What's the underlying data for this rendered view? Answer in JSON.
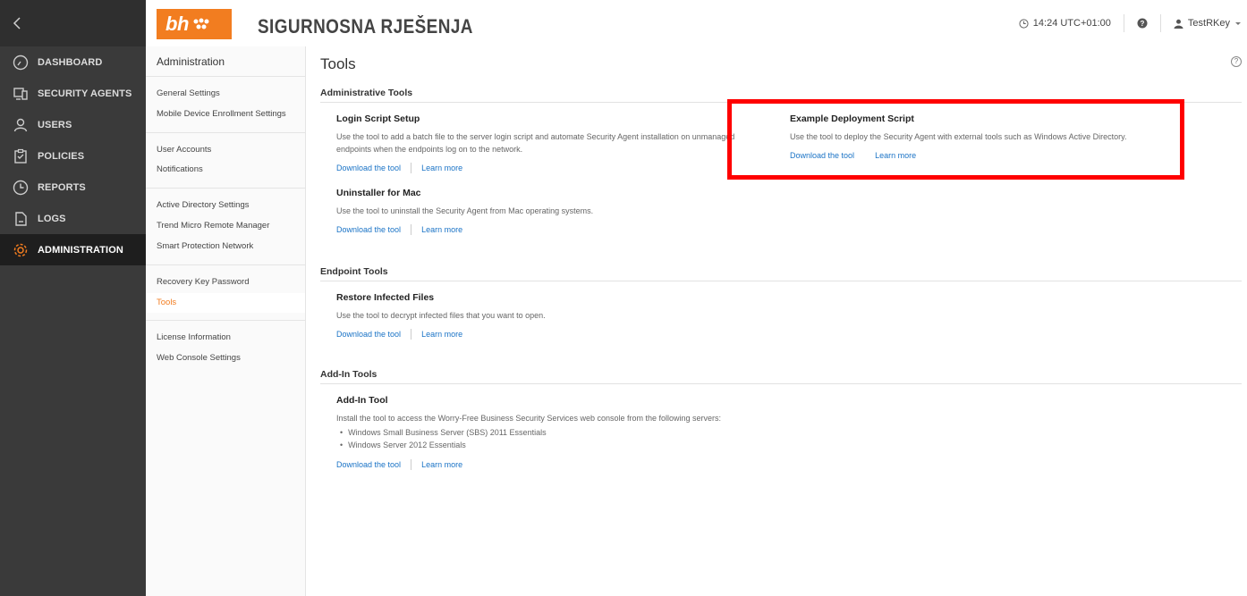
{
  "nav": {
    "items": [
      {
        "key": "dashboard",
        "label": "DASHBOARD",
        "icon": "dashboard-icon"
      },
      {
        "key": "security-agents",
        "label": "SECURITY AGENTS",
        "icon": "devices-icon"
      },
      {
        "key": "users",
        "label": "USERS",
        "icon": "user-icon"
      },
      {
        "key": "policies",
        "label": "POLICIES",
        "icon": "clipboard-icon"
      },
      {
        "key": "reports",
        "label": "REPORTS",
        "icon": "clock-icon"
      },
      {
        "key": "logs",
        "label": "LOGS",
        "icon": "document-icon"
      },
      {
        "key": "administration",
        "label": "ADMINISTRATION",
        "icon": "gear-icon",
        "active": true
      }
    ]
  },
  "header": {
    "logo_text": "bh",
    "brand": "SIGURNOSNA RJEŠENJA",
    "time": "14:24 UTC+01:00",
    "user": "TestRKey"
  },
  "subnav": {
    "title": "Administration",
    "items": {
      "general_settings": "General Settings",
      "mobile_enrollment": "Mobile Device Enrollment Settings",
      "user_accounts": "User Accounts",
      "notifications": "Notifications",
      "active_directory": "Active Directory Settings",
      "remote_manager": "Trend Micro Remote Manager",
      "smart_protection": "Smart Protection Network",
      "recovery_key": "Recovery Key Password",
      "tools": "Tools",
      "license": "License Information",
      "web_console": "Web Console Settings"
    }
  },
  "main": {
    "title": "Tools",
    "sections": {
      "administrative": "Administrative Tools",
      "endpoint": "Endpoint Tools",
      "addin": "Add-In Tools"
    },
    "tools": {
      "login_script": {
        "title": "Login Script Setup",
        "desc": "Use the tool to add a batch file to the server login script and automate Security Agent installation on unmanaged endpoints when the endpoints log on to the network."
      },
      "example_deployment": {
        "title": "Example Deployment Script",
        "desc": "Use the tool to deploy the Security Agent with external tools such as Windows Active Directory."
      },
      "uninstaller_mac": {
        "title": "Uninstaller for Mac",
        "desc": "Use the tool to uninstall the Security Agent from Mac operating systems."
      },
      "restore_infected": {
        "title": "Restore Infected Files",
        "desc": "Use the tool to decrypt infected files that you want to open."
      },
      "addin_tool": {
        "title": "Add-In Tool",
        "desc": "Install the tool to access the Worry-Free Business Security Services web console from the following servers:",
        "bullets": [
          "Windows Small Business Server (SBS) 2011 Essentials",
          "Windows Server 2012 Essentials"
        ]
      }
    },
    "links": {
      "download": "Download the tool",
      "learn": "Learn more"
    }
  },
  "colors": {
    "accent": "#f27d20",
    "link": "#1a73c6",
    "highlight": "#ff0000",
    "nav_bg": "#3a3a3a"
  }
}
